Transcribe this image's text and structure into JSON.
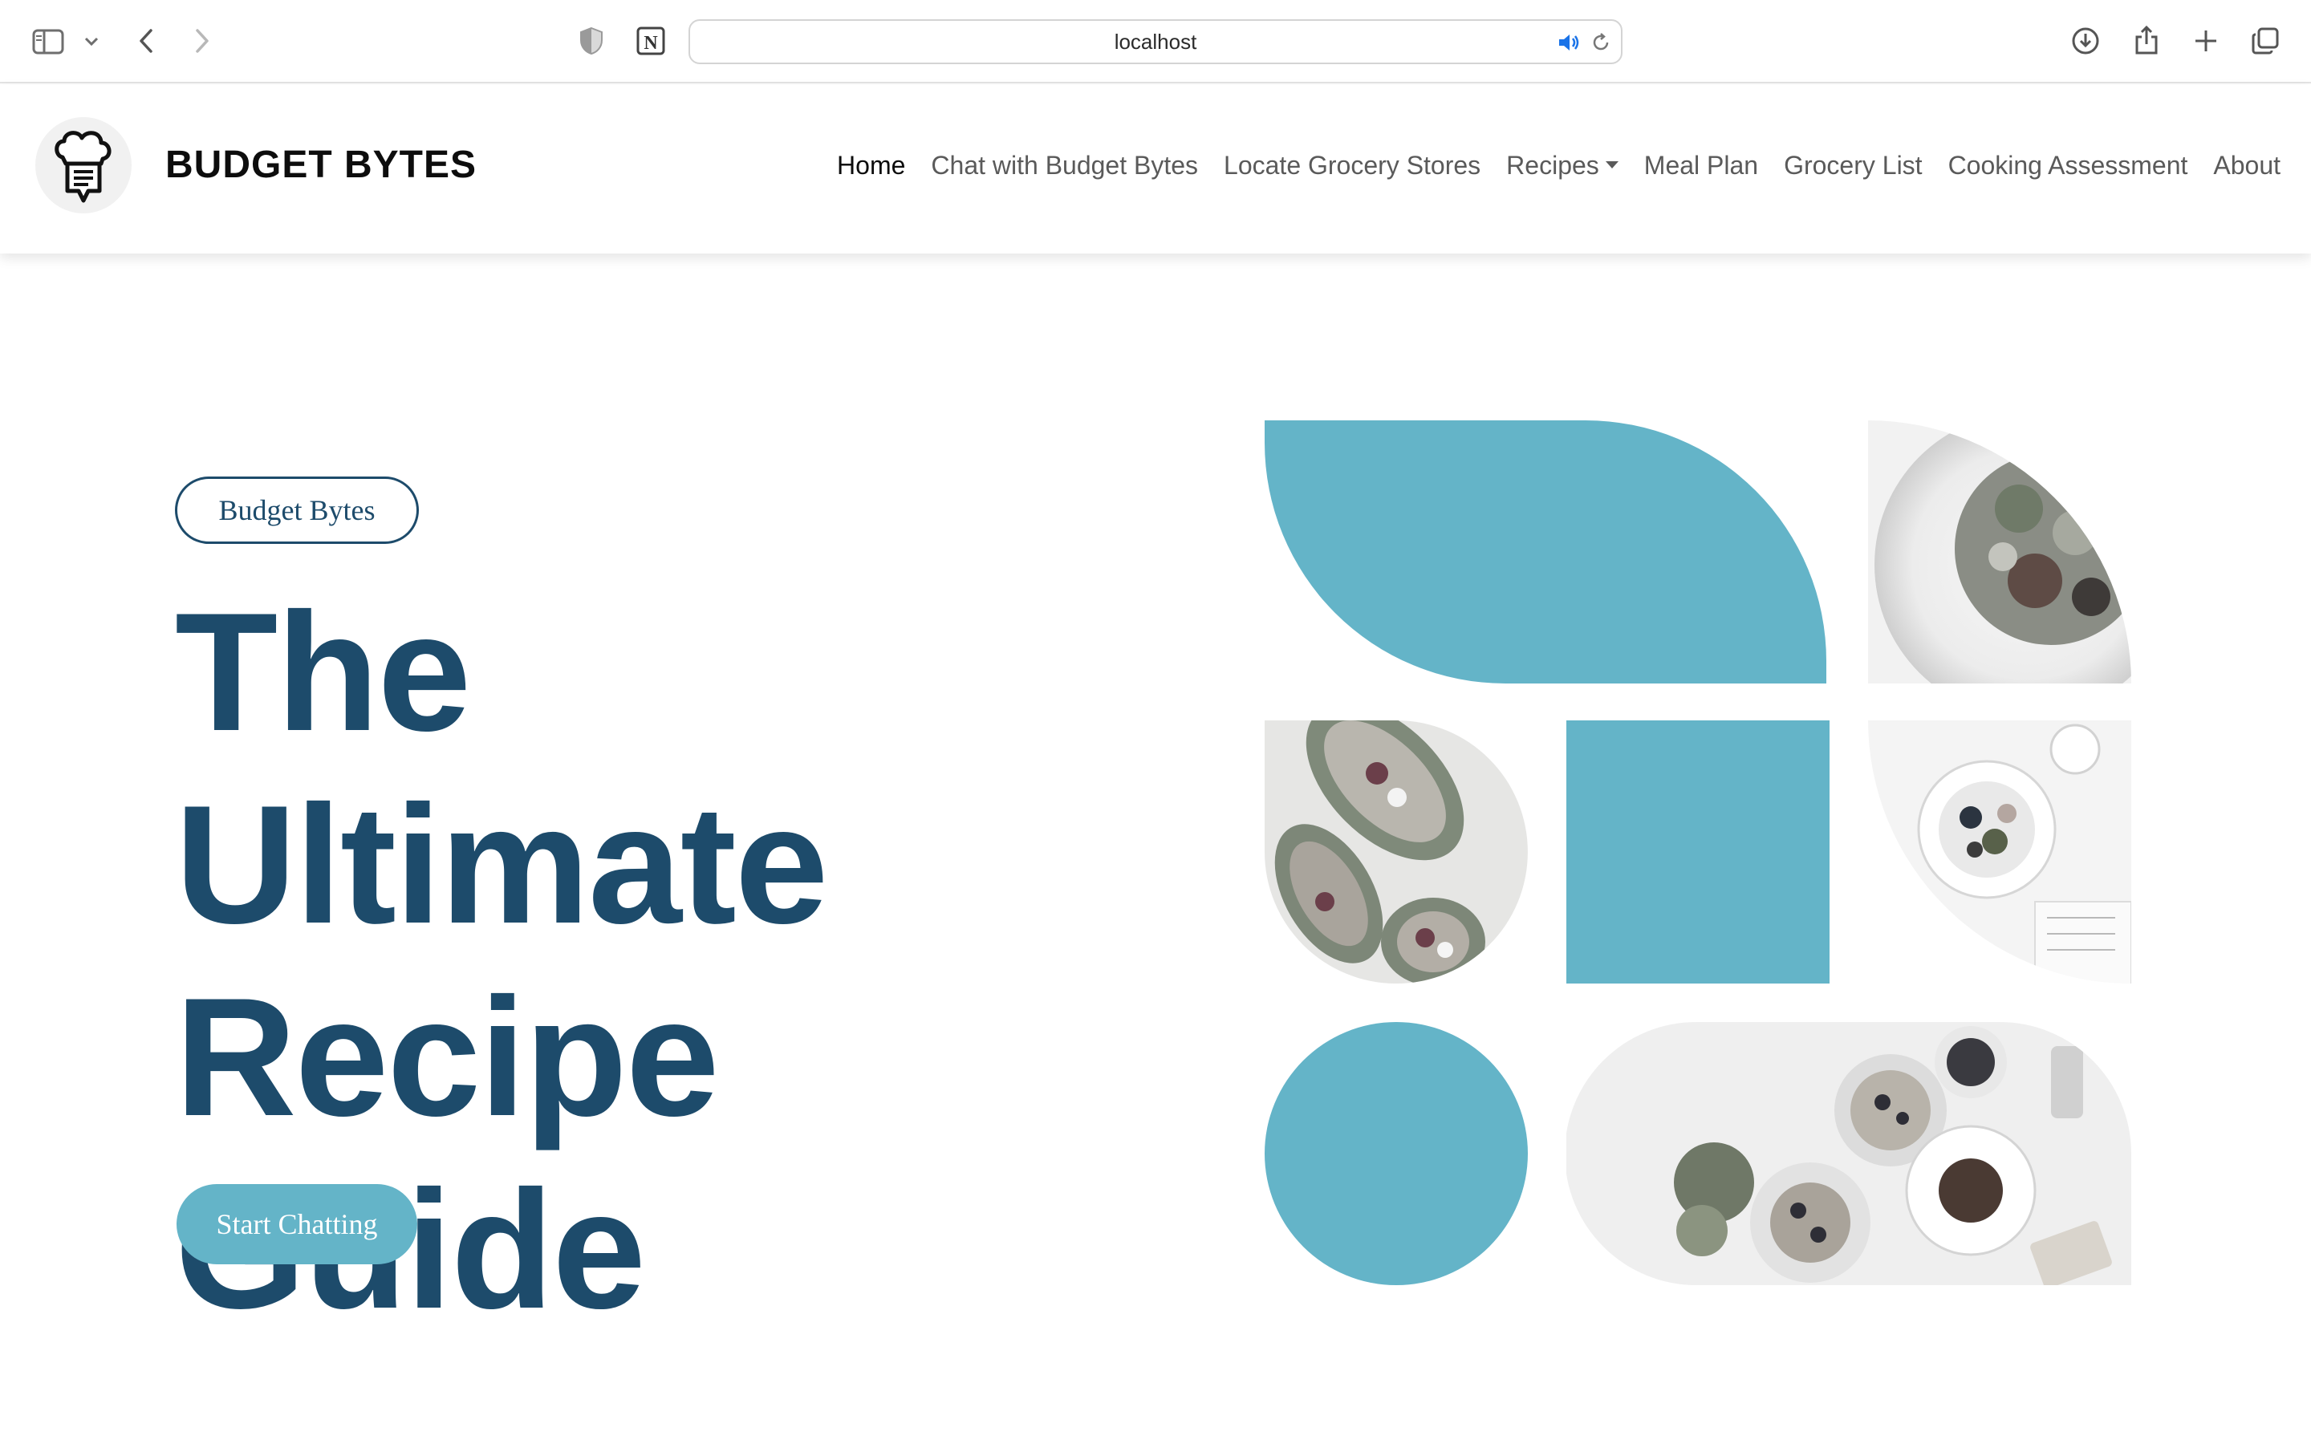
{
  "browser": {
    "address": "localhost",
    "icons": [
      "sidebar-icon",
      "chevron-down-icon",
      "back-icon",
      "forward-icon",
      "privacy-shield-icon",
      "notion-extension-icon",
      "audio-playing-icon",
      "reload-icon",
      "download-icon",
      "share-icon",
      "new-tab-icon",
      "tabs-overview-icon"
    ]
  },
  "header": {
    "brand": "BUDGET BYTES",
    "logo_icon": "chef-chat-icon",
    "nav": [
      {
        "label": "Home",
        "active": true
      },
      {
        "label": "Chat with Budget Bytes",
        "active": false
      },
      {
        "label": "Locate Grocery Stores",
        "active": false
      },
      {
        "label": "Recipes",
        "active": false,
        "dropdown": true
      },
      {
        "label": "Meal Plan",
        "active": false
      },
      {
        "label": "Grocery List",
        "active": false
      },
      {
        "label": "Cooking Assessment",
        "active": false
      },
      {
        "label": "About",
        "active": false
      }
    ]
  },
  "hero": {
    "badge": "Budget Bytes",
    "title_lines": [
      "The Ultimate",
      "Recipe",
      "Guide"
    ],
    "cta": "Start Chatting"
  },
  "mosaic": {
    "images": [
      "pasta-salad-photo",
      "stuffed-avocado-photo",
      "fruit-bowl-photo",
      "breakfast-table-photo"
    ]
  },
  "colors": {
    "primary": "#1d4b6b",
    "accent": "#64b4c8",
    "text": "#5a5a5a"
  }
}
